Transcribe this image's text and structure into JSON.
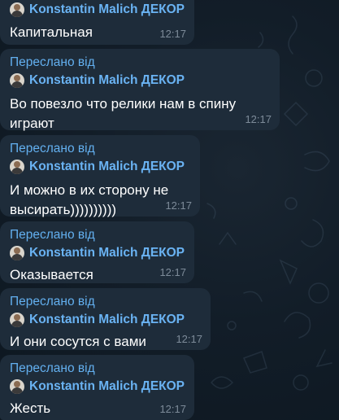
{
  "chat": {
    "partial_top_message": {
      "author": "Konstantin Malich ДЕКОР",
      "text": "Капитальная",
      "time": "12:17"
    },
    "messages": [
      {
        "forwarded_label": "Переслано від",
        "author": "Konstantin Malich ДЕКОР",
        "text_lines": [
          "Во повезло что релики нам в спину",
          "играют"
        ],
        "time": "12:17"
      },
      {
        "forwarded_label": "Переслано від",
        "author": "Konstantin Malich ДЕКОР",
        "text_lines": [
          "И можно в их сторону не",
          "высирать))))))))))"
        ],
        "time": "12:17"
      },
      {
        "forwarded_label": "Переслано від",
        "author": "Konstantin Malich ДЕКОР",
        "text_lines": [
          "Оказывается"
        ],
        "time": "12:17"
      },
      {
        "forwarded_label": "Переслано від",
        "author": "Konstantin Malich ДЕКОР",
        "text_lines": [
          "И они сосутся с вами"
        ],
        "time": "12:17"
      },
      {
        "forwarded_label": "Переслано від",
        "author": "Konstantin Malich ДЕКОР",
        "text_lines": [
          "Жесть"
        ],
        "time": "12:17"
      }
    ]
  },
  "colors": {
    "background": "#0f1a25",
    "bubble": "#1e2c3a",
    "forward_label": "#63b0f0",
    "author_name": "#6ab3f3",
    "message_text": "#ffffff",
    "timestamp": "#7d8b99"
  }
}
